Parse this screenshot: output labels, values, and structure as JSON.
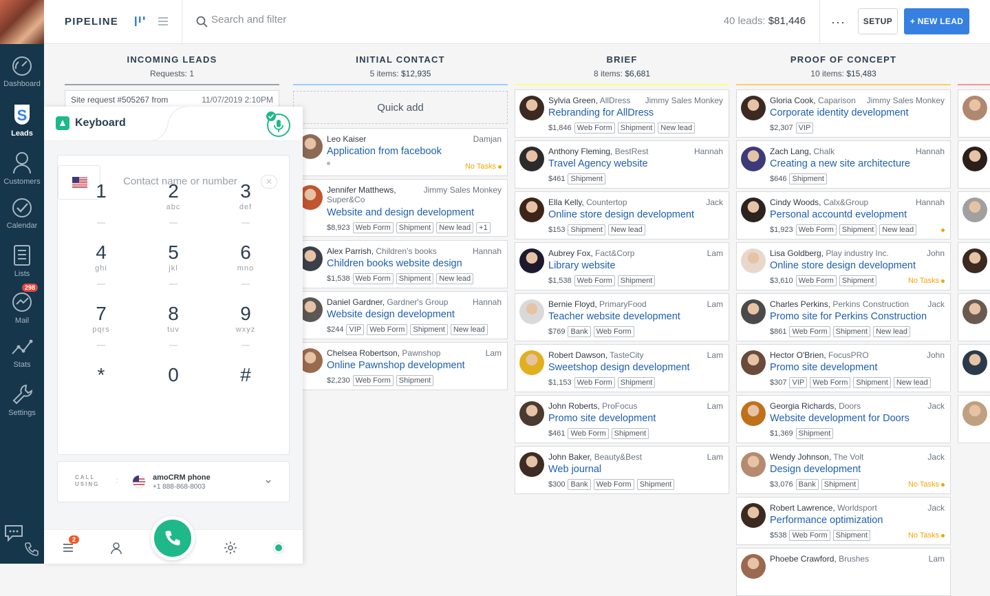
{
  "sidebar": {
    "items": [
      {
        "label": "Dashboard"
      },
      {
        "label": "Leads"
      },
      {
        "label": "Customers"
      },
      {
        "label": "Calendar"
      },
      {
        "label": "Lists"
      },
      {
        "label": "Mail",
        "badge": "298"
      },
      {
        "label": "Stats"
      },
      {
        "label": "Settings"
      }
    ]
  },
  "header": {
    "title": "PIPELINE",
    "search_placeholder": "Search and filter",
    "leads_count": "40 leads:",
    "leads_total": "$81,446",
    "more": "···",
    "setup_label": "SETUP",
    "new_lead_label": "+ NEW LEAD"
  },
  "columns": [
    {
      "name": "INCOMING LEADS",
      "summary": "Requests: 1",
      "color": "#99a1a8",
      "request": {
        "title": "Site request #505267 from",
        "date": "11/07/2019 2:10PM"
      }
    },
    {
      "name": "INITIAL CONTACT",
      "summary_count": "5 items:",
      "summary_value": "$12,935",
      "color": "#99ccff",
      "quick_add": "Quick add",
      "cards": [
        {
          "name": "Leo Kaiser",
          "company": "",
          "owner": "Damjan",
          "title": "Application from facebook",
          "price": "",
          "tags": [],
          "notask": "No Tasks",
          "avatar": "#8c6a55"
        },
        {
          "name": "Jennifer Matthews,",
          "company": "Super&Co",
          "owner": "Jimmy Sales Monkey",
          "title": "Website and design development",
          "price": "$8,923",
          "tags": [
            "Web Form",
            "Shipment",
            "New lead",
            "+1"
          ],
          "notask": "",
          "avatar": "#c1552f"
        },
        {
          "name": "Alex Parrish,",
          "company": "Children's books",
          "owner": "Hannah",
          "title": "Children books website design",
          "price": "$1,538",
          "tags": [
            "Web Form",
            "Shipment",
            "New lead"
          ],
          "notask": "",
          "avatar": "#3b3f4a"
        },
        {
          "name": "Daniel Gardner,",
          "company": "Gardner's Group",
          "owner": "Hannah",
          "title": "Website design development",
          "price": "$244",
          "tags": [
            "VIP",
            "Web Form",
            "Shipment",
            "New lead"
          ],
          "notask": "",
          "avatar": "#5d5753"
        },
        {
          "name": "Chelsea Robertson,",
          "company": "Pawnshop",
          "owner": "Lam",
          "title": "Online Pawnshop development",
          "price": "$2,230",
          "tags": [
            "Web Form",
            "Shipment"
          ],
          "notask": "",
          "avatar": "#9a6a4f"
        }
      ]
    },
    {
      "name": "BRIEF",
      "summary_count": "8 items:",
      "summary_value": "$6,681",
      "color": "#fffd7f",
      "cards": [
        {
          "name": "Sylvia Green,",
          "company": "AllDress",
          "owner": "Jimmy Sales Monkey",
          "title": "Rebranding for AllDress",
          "price": "$1,846",
          "tags": [
            "Web Form",
            "Shipment",
            "New lead"
          ],
          "notask": "",
          "avatar": "#3a2a22"
        },
        {
          "name": "Anthony Fleming,",
          "company": "BestRest",
          "owner": "Hannah",
          "title": "Travel Agency website",
          "price": "$461",
          "tags": [
            "Shipment"
          ],
          "notask": "",
          "avatar": "#2b2b2b"
        },
        {
          "name": "Ella Kelly,",
          "company": "Countertop",
          "owner": "Jack",
          "title": "Online store design development",
          "price": "$153",
          "tags": [
            "Shipment",
            "New lead"
          ],
          "notask": "",
          "avatar": "#3c2418"
        },
        {
          "name": "Aubrey Fox,",
          "company": "Fact&Corp",
          "owner": "Lam",
          "title": "Library website",
          "price": "$1,538",
          "tags": [
            "Web Form",
            "Shipment"
          ],
          "notask": "",
          "avatar": "#1e1a2e"
        },
        {
          "name": "Bernie Floyd,",
          "company": "PrimaryFood",
          "owner": "Lam",
          "title": "Teacher website development",
          "price": "$769",
          "tags": [
            "Bank",
            "Web Form"
          ],
          "notask": "",
          "avatar": "#d9d9d9"
        },
        {
          "name": "Robert Dawson,",
          "company": "TasteCity",
          "owner": "Lam",
          "title": "Sweetshop design development",
          "price": "$1,153",
          "tags": [
            "Web Form",
            "Shipment"
          ],
          "notask": "",
          "avatar": "#e0b020"
        },
        {
          "name": "John Roberts,",
          "company": "ProFocus",
          "owner": "Lam",
          "title": "Promo site development",
          "price": "$461",
          "tags": [
            "Web Form",
            "Shipment"
          ],
          "notask": "",
          "avatar": "#4a3a30"
        },
        {
          "name": "John Baker,",
          "company": "Beauty&Best",
          "owner": "Lam",
          "title": "Web journal",
          "price": "$300",
          "tags": [
            "Bank",
            "Web Form",
            "Shipment"
          ],
          "notask": "",
          "avatar": "#3d2c24"
        }
      ]
    },
    {
      "name": "PROOF OF CONCEPT",
      "summary_count": "10 items:",
      "summary_value": "$15,483",
      "color": "#ffcc66",
      "cards": [
        {
          "name": "Gloria Cook,",
          "company": "Caparison",
          "owner": "Jimmy Sales Monkey",
          "title": "Corporate identity development",
          "price": "$2,307",
          "tags": [
            "VIP"
          ],
          "notask": "",
          "avatar": "#3a2a22"
        },
        {
          "name": "Zach Lang,",
          "company": "Chalk",
          "owner": "Hannah",
          "title": "Creating a new site architecture",
          "price": "$646",
          "tags": [
            "Shipment"
          ],
          "notask": "",
          "avatar": "#3d3a7a"
        },
        {
          "name": "Cindy Woods,",
          "company": "Calx&Group",
          "owner": "Hannah",
          "title": "Personal accountd evelopment",
          "price": "$1,923",
          "tags": [
            "Web Form",
            "Shipment",
            "New lead"
          ],
          "notask": "dot",
          "avatar": "#2a2320"
        },
        {
          "name": "Lisa Goldberg,",
          "company": "Play industry Inc.",
          "owner": "John",
          "title": "Online store design development",
          "price": "$3,610",
          "tags": [
            "Web Form",
            "Shipment"
          ],
          "notask": "No Tasks",
          "avatar": "#e8d8cc"
        },
        {
          "name": "Charles Perkins,",
          "company": "Perkins Construction",
          "owner": "Jack",
          "title": "Promo site for Perkins Construction",
          "price": "$861",
          "tags": [
            "Web Form",
            "Shipment",
            "New lead"
          ],
          "notask": "",
          "avatar": "#4a4a4a"
        },
        {
          "name": "Hector O'Brien,",
          "company": "FocusPRO",
          "owner": "John",
          "title": "Promo site development",
          "price": "$307",
          "tags": [
            "VIP",
            "Web Form",
            "Shipment",
            "New lead"
          ],
          "notask": "",
          "avatar": "#6a4a3a"
        },
        {
          "name": "Georgia Richards,",
          "company": "Doors",
          "owner": "Jack",
          "title": "Website development for Doors",
          "price": "$1,369",
          "tags": [
            "Shipment"
          ],
          "notask": "",
          "avatar": "#c0701a"
        },
        {
          "name": "Wendy Johnson,",
          "company": "The Volt",
          "owner": "Jack",
          "title": "Design development",
          "price": "$3,076",
          "tags": [
            "Bank",
            "Shipment"
          ],
          "notask": "No Tasks",
          "avatar": "#b58a70"
        },
        {
          "name": "Robert Lawrence,",
          "company": "Worldsport",
          "owner": "Jack",
          "title": "Performance optimization",
          "price": "$538",
          "tags": [
            "Web Form",
            "Shipment"
          ],
          "notask": "No Tasks",
          "avatar": "#3a2a20"
        },
        {
          "name": "Phoebe Crawford,",
          "company": "Brushes",
          "owner": "Lam",
          "title": "",
          "price": "",
          "tags": [],
          "notask": "",
          "avatar": "#9a6a50"
        }
      ]
    },
    {
      "color": "#ff8f92",
      "avatars": [
        "#b08870",
        "#2a1f1a",
        "#a0a0a0",
        "#3a2a20",
        "#6a5a50",
        "#2a3a4a",
        "#c0a080"
      ]
    }
  ],
  "keyboard": {
    "title": "Keyboard",
    "contact_placeholder": "Contact name or number",
    "keys": [
      {
        "digit": "1",
        "letters": ""
      },
      {
        "digit": "2",
        "letters": "abc"
      },
      {
        "digit": "3",
        "letters": "def"
      },
      {
        "digit": "4",
        "letters": "ghi"
      },
      {
        "digit": "5",
        "letters": "jkl"
      },
      {
        "digit": "6",
        "letters": "mno"
      },
      {
        "digit": "7",
        "letters": "pqrs"
      },
      {
        "digit": "8",
        "letters": "tuv"
      },
      {
        "digit": "9",
        "letters": "wxyz"
      },
      {
        "digit": "*",
        "letters": ""
      },
      {
        "digit": "0",
        "letters": ""
      },
      {
        "digit": "#",
        "letters": ""
      }
    ],
    "call_using_1": "CALL",
    "call_using_2": "USING",
    "phone_name": "amoCRM phone",
    "phone_number": "+1 888-868-8003",
    "badge": "2"
  },
  "colors": {
    "sidebar": "#15364b",
    "accent": "#3580e0",
    "green": "#1fb88a",
    "link": "#1d5fb0",
    "warning": "#f0a500"
  }
}
